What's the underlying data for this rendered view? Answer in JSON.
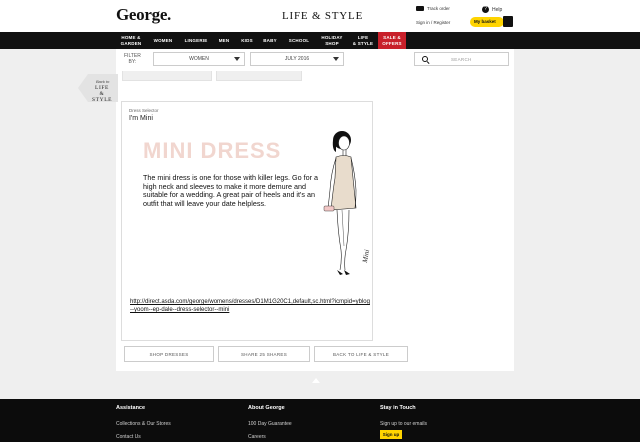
{
  "header": {
    "logo": "George.",
    "section_title": "LIFE & STYLE",
    "track_order": "Track order",
    "help": "Help",
    "help_glyph": "?",
    "sign_in": "Sign in / Register",
    "basket_label": "My basket"
  },
  "nav": {
    "items": [
      {
        "line1": "HOME &",
        "line2": "GARDEN"
      },
      {
        "line1": "WOMEN",
        "line2": ""
      },
      {
        "line1": "LINGERIE",
        "line2": ""
      },
      {
        "line1": "MEN",
        "line2": ""
      },
      {
        "line1": "KIDS",
        "line2": ""
      },
      {
        "line1": "BABY",
        "line2": ""
      },
      {
        "line1": "SCHOOL",
        "line2": ""
      },
      {
        "line1": "HOLIDAY",
        "line2": "SHOP"
      },
      {
        "line1": "LIFE",
        "line2": "& STYLE"
      },
      {
        "line1": "SALE &",
        "line2": "OFFERS"
      }
    ]
  },
  "filter": {
    "label_line1": "FILTER",
    "label_line2": "BY:",
    "category_value": "WOMEN",
    "date_value": "JULY 2016",
    "search_placeholder": "SEARCH"
  },
  "back": {
    "small": "Back to",
    "line1": "LIFE &",
    "line2": "STYLE"
  },
  "article": {
    "eyebrow": "Dress Selector",
    "title": "I'm Mini",
    "big_title": "MINI DRESS",
    "description": "The mini dress is one for those with killer legs. Go for a high neck and sleeves to make it more demure and suitable for a wedding. A great pair of heels and it's an outfit that will leave your date helpless.",
    "illustration_signature": "Mini",
    "link": "http://direct.asda.com/george/womens/dresses/D1M1G20C1,default,sc.html?icmpid=yblog--yoom--ep-dale--dress-selector--mini"
  },
  "buttons": {
    "shop": "SHOP DRESSES",
    "share": "SHARE 25 SHARES",
    "back": "BACK TO LIFE & STYLE"
  },
  "footer": {
    "col1_title": "Assistance",
    "col1_links": [
      "Collections & Our Stores",
      "Contact Us"
    ],
    "col2_title": "About George",
    "col2_links": [
      "100 Day Guarantee",
      "Careers"
    ],
    "col3_title": "Stay in Touch",
    "col3_text": "Sign up to our emails",
    "signup_label": "Sign up"
  },
  "colors": {
    "accent_yellow": "#ffd400",
    "sale_red": "#c8202a",
    "title_pink": "#f1d6cf"
  }
}
